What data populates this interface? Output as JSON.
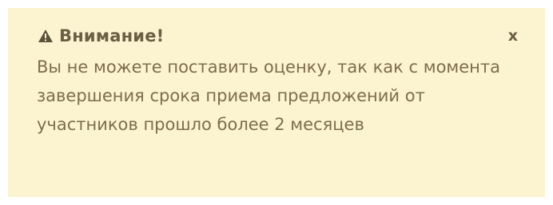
{
  "alert": {
    "icon": "warning-triangle-icon",
    "title": "Внимание!",
    "close_label": "x",
    "message": "Вы не можете поставить оценку, так как с момента завершения срока приема предложений от участников прошло более 2 месяцев",
    "colors": {
      "background": "#fcf4d1",
      "text": "#7d6d4b",
      "title": "#6b5e42"
    }
  }
}
